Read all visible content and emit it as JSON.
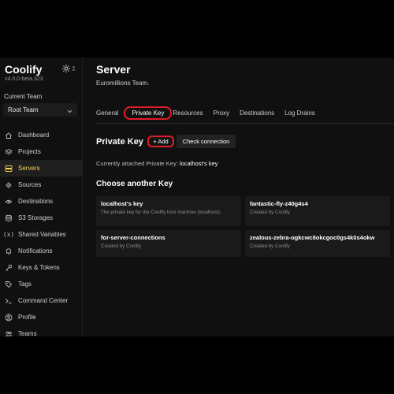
{
  "sidebar": {
    "brand": "Coolify",
    "version": "v4.0.0-beta.323",
    "team_label": "Current Team",
    "team_value": "Root Team",
    "items": [
      {
        "label": "Dashboard",
        "icon": "home-icon",
        "active": false
      },
      {
        "label": "Projects",
        "icon": "layers-icon",
        "active": false
      },
      {
        "label": "Servers",
        "icon": "server-icon",
        "active": true
      },
      {
        "label": "Sources",
        "icon": "git-branch-icon",
        "active": false
      },
      {
        "label": "Destinations",
        "icon": "destination-icon",
        "active": false
      },
      {
        "label": "S3 Storages",
        "icon": "database-icon",
        "active": false
      },
      {
        "label": "Shared Variables",
        "icon": "variables-icon",
        "active": false
      },
      {
        "label": "Notifications",
        "icon": "bell-icon",
        "active": false
      },
      {
        "label": "Keys & Tokens",
        "icon": "key-icon",
        "active": false
      },
      {
        "label": "Tags",
        "icon": "tag-icon",
        "active": false
      },
      {
        "label": "Command Center",
        "icon": "terminal-icon",
        "active": false
      },
      {
        "label": "Profile",
        "icon": "user-icon",
        "active": false
      },
      {
        "label": "Teams",
        "icon": "users-icon",
        "active": false
      }
    ],
    "active_color": "#fcd34d"
  },
  "main": {
    "title": "Server",
    "subtitle": "Euromillions Team.",
    "tabs": [
      "General",
      "Private Key",
      "Resources",
      "Proxy",
      "Destinations",
      "Log Drains"
    ],
    "active_tab": "Private Key",
    "section_title": "Private Key",
    "add_label": "+ Add",
    "check_label": "Check connection",
    "attached_prefix": "Currently attached Private Key:",
    "attached_key": "localhost's key",
    "choose_title": "Choose another Key",
    "keys": [
      {
        "name": "localhost's key",
        "desc": "The private key for the Coolify host machine (localhost)."
      },
      {
        "name": "fantastic-fly-z40g4s4",
        "desc": "Created by Coolify"
      },
      {
        "name": "for-server-connections",
        "desc": "Created by Coolify"
      },
      {
        "name": "zealous-zebra-ogkcwc8okcgoc0gs4k0s4okw",
        "desc": "Created by Coolify"
      }
    ],
    "highlight_color": "#e11d2a"
  }
}
